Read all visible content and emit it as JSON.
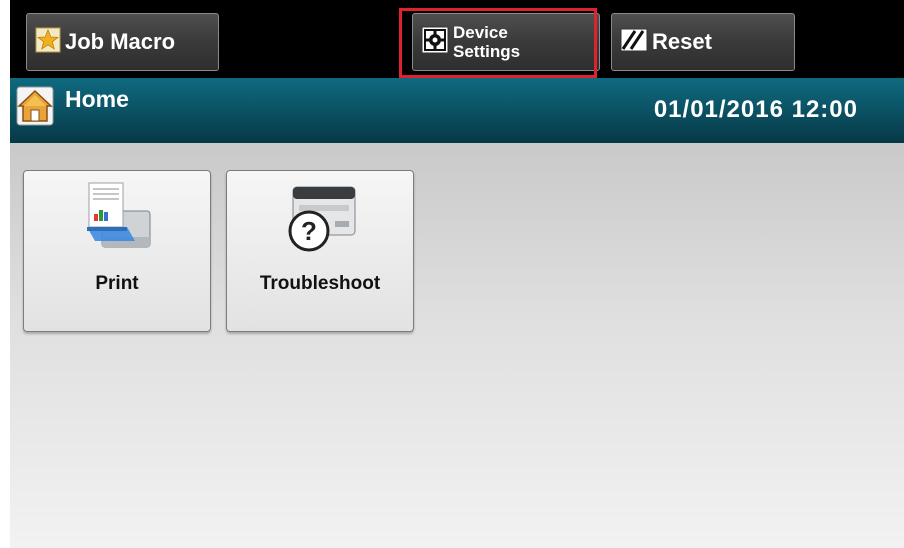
{
  "toolbar": {
    "job_macro": {
      "label": "Job Macro",
      "icon": "star-icon"
    },
    "device_settings": {
      "label_line1": "Device",
      "label_line2": "Settings",
      "icon": "gear-icon"
    },
    "reset": {
      "label": "Reset",
      "icon": "reset-icon"
    },
    "highlight_color": "#e0212e"
  },
  "header": {
    "title": "Home",
    "icon": "home-icon",
    "datetime": "01/01/2016 12:00"
  },
  "tiles": [
    {
      "label": "Print",
      "icon": "print-icon"
    },
    {
      "label": "Troubleshoot",
      "icon": "troubleshoot-icon"
    }
  ],
  "colors": {
    "header_bg": "#0a4d5e",
    "toolbar_bg": "#000000"
  }
}
